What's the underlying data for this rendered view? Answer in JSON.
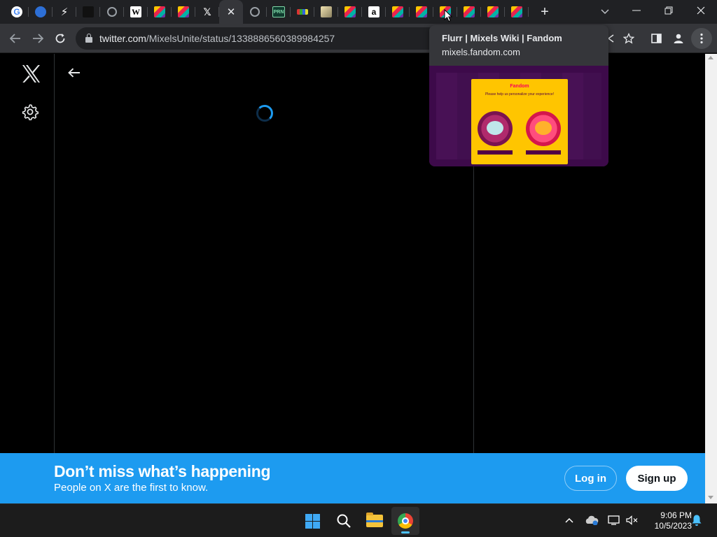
{
  "browser": {
    "tabs": [
      {
        "icon": "google-icon",
        "glyph": "G",
        "style": "google",
        "active": false
      },
      {
        "icon": "drupal-icon",
        "glyph": "",
        "style": "blue",
        "active": false
      },
      {
        "icon": "bolt-icon",
        "glyph": "⚡",
        "style": "bolt",
        "active": false
      },
      {
        "icon": "dark-figure-icon",
        "glyph": "",
        "style": "dark",
        "active": false
      },
      {
        "icon": "globe-icon",
        "glyph": "",
        "style": "globe",
        "active": false
      },
      {
        "icon": "wikipedia-icon",
        "glyph": "W",
        "style": "wiki",
        "active": false
      },
      {
        "icon": "fandom-icon",
        "glyph": "",
        "style": "fandom",
        "active": false
      },
      {
        "icon": "fandom-icon",
        "glyph": "",
        "style": "fandom",
        "active": false
      },
      {
        "icon": "x-icon",
        "glyph": "𝕏",
        "style": "x",
        "active": false
      },
      {
        "icon": "close-icon",
        "glyph": "✕",
        "style": "close",
        "active": true
      },
      {
        "icon": "globe-icon",
        "glyph": "",
        "style": "globe",
        "active": false
      },
      {
        "icon": "prn-icon",
        "glyph": "PRN",
        "style": "prn",
        "active": false
      },
      {
        "icon": "stripes-icon",
        "glyph": "",
        "style": "stripes",
        "active": false
      },
      {
        "icon": "image-icon",
        "glyph": "",
        "style": "img",
        "active": false
      },
      {
        "icon": "fandom-icon",
        "glyph": "",
        "style": "fandom",
        "active": false
      },
      {
        "icon": "amazon-icon",
        "glyph": "a",
        "style": "amazon",
        "active": false
      },
      {
        "icon": "fandom-icon",
        "glyph": "",
        "style": "fandom",
        "active": false
      },
      {
        "icon": "fandom-icon",
        "glyph": "",
        "style": "fandom",
        "active": false
      },
      {
        "icon": "fandom-icon",
        "glyph": "",
        "style": "fandom",
        "active": false
      },
      {
        "icon": "fandom-icon",
        "glyph": "",
        "style": "fandom",
        "active": false
      },
      {
        "icon": "fandom-icon",
        "glyph": "",
        "style": "fandom",
        "active": false
      },
      {
        "icon": "fandom-icon",
        "glyph": "",
        "style": "fandom",
        "active": false
      }
    ],
    "new_tab_glyph": "+",
    "tab_search_glyph": "⌄",
    "window_controls": {
      "minimize": "—",
      "restore": "❐",
      "close": "✕"
    },
    "address": {
      "host": "twitter.com",
      "path": "/MixelsUnite/status/1338886560389984257"
    },
    "toolbar_glyphs": {
      "back": "←",
      "forward": "→",
      "reload": "↻",
      "bookmark": "☆",
      "sidepanel": "▣",
      "profile": "👤",
      "menu": "⋮"
    }
  },
  "hover_card": {
    "title": "Flurr | Mixels Wiki | Fandom",
    "domain": "mixels.fandom.com",
    "preview_brand": "Fandom",
    "preview_text": "Please help us personalize your experience!"
  },
  "page": {
    "back_glyph": "←",
    "x_logo_glyph": "𝕏"
  },
  "banner": {
    "title": "Don’t miss what’s happening",
    "subtitle": "People on X are the first to know.",
    "login_label": "Log in",
    "signup_label": "Sign up"
  },
  "taskbar": {
    "time": "9:06 PM",
    "date": "10/5/2023",
    "tray_glyphs": {
      "chevron": "^",
      "onedrive": "☁",
      "network": "▭",
      "volume": "🔇"
    }
  },
  "colors": {
    "accent": "#1d9bf0",
    "page_bg": "#000000",
    "chrome_dark": "#202124"
  }
}
